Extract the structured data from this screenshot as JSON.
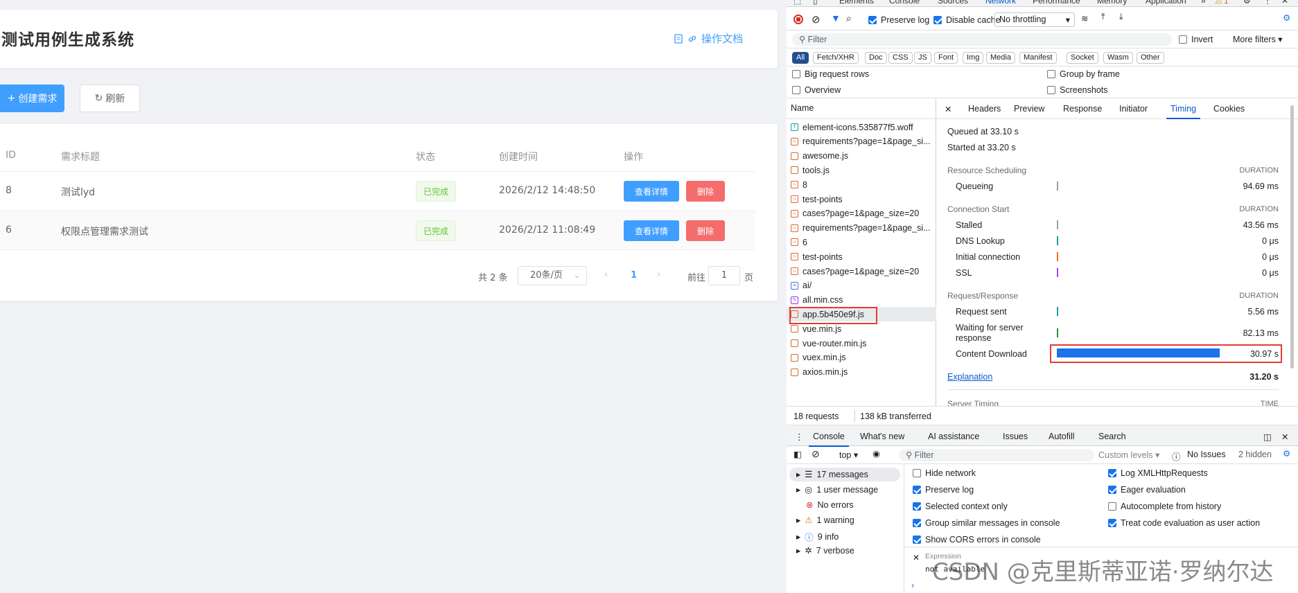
{
  "app": {
    "title": "测试用例生成系统",
    "doc_link": "操作文档",
    "create_btn": "创建需求",
    "refresh_btn": "刷新",
    "columns": [
      "ID",
      "需求标题",
      "状态",
      "创建时间",
      "操作"
    ],
    "rows": [
      {
        "id": "8",
        "title": "测试lyd",
        "status": "已完成",
        "created": "2026/2/12 14:48:50",
        "view": "查看详情",
        "del": "删除"
      },
      {
        "id": "6",
        "title": "权限点管理需求测试",
        "status": "已完成",
        "created": "2026/2/12 11:08:49",
        "view": "查看详情",
        "del": "删除"
      }
    ],
    "pagination": {
      "total": "共 2 条",
      "page_size": "20条/页",
      "current": "1",
      "goto_label": "前往",
      "goto_value": "1",
      "page_suffix": "页"
    }
  },
  "devtools": {
    "panels": [
      "Elements",
      "Console",
      "Sources",
      "Network",
      "Performance",
      "Memory",
      "Application"
    ],
    "active_panel": "Network",
    "warning_count": "1",
    "preserve_log": "Preserve log",
    "disable_cache": "Disable cache",
    "throttling": "No throttling",
    "filter_placeholder": "Filter",
    "invert": "Invert",
    "more_filters": "More filters",
    "types": [
      "All",
      "Fetch/XHR",
      "Doc",
      "CSS",
      "JS",
      "Font",
      "Img",
      "Media",
      "Manifest",
      "Socket",
      "Wasm",
      "Other"
    ],
    "options": {
      "big_rows": "Big request rows",
      "group_frame": "Group by frame",
      "overview": "Overview",
      "screenshots": "Screenshots"
    },
    "name_header": "Name",
    "requests": [
      {
        "name": "element-icons.535877f5.woff",
        "kind": "font"
      },
      {
        "name": "requirements?page=1&page_si...",
        "kind": "xhr"
      },
      {
        "name": "awesome.js",
        "kind": "js"
      },
      {
        "name": "tools.js",
        "kind": "js"
      },
      {
        "name": "8",
        "kind": "xhr"
      },
      {
        "name": "test-points",
        "kind": "xhr"
      },
      {
        "name": "cases?page=1&page_size=20",
        "kind": "xhr"
      },
      {
        "name": "requirements?page=1&page_si...",
        "kind": "xhr"
      },
      {
        "name": "6",
        "kind": "xhr"
      },
      {
        "name": "test-points",
        "kind": "xhr"
      },
      {
        "name": "cases?page=1&page_size=20",
        "kind": "xhr"
      },
      {
        "name": "ai/",
        "kind": "doc"
      },
      {
        "name": "all.min.css",
        "kind": "css"
      },
      {
        "name": "app.5b450e9f.js",
        "kind": "js",
        "selected": true
      },
      {
        "name": "vue.min.js",
        "kind": "js"
      },
      {
        "name": "vue-router.min.js",
        "kind": "js"
      },
      {
        "name": "vuex.min.js",
        "kind": "js"
      },
      {
        "name": "axios.min.js",
        "kind": "js"
      }
    ],
    "detail_tabs": [
      "Headers",
      "Preview",
      "Response",
      "Initiator",
      "Timing",
      "Cookies"
    ],
    "active_detail_tab": "Timing",
    "timing": {
      "queued": "Queued at 33.10 s",
      "started": "Started at 33.20 s",
      "duration_label": "DURATION",
      "sections": [
        {
          "name": "Resource Scheduling",
          "rows": [
            {
              "label": "Queueing",
              "value": "94.69 ms",
              "color": "#9e9e9e"
            }
          ]
        },
        {
          "name": "Connection Start",
          "rows": [
            {
              "label": "Stalled",
              "value": "43.56 ms",
              "color": "#9e9e9e"
            },
            {
              "label": "DNS Lookup",
              "value": "0 μs",
              "color": "#1a9c9c"
            },
            {
              "label": "Initial connection",
              "value": "0 μs",
              "color": "#e8710a"
            },
            {
              "label": "SSL",
              "value": "0 μs",
              "color": "#a142f4"
            }
          ]
        },
        {
          "name": "Request/Response",
          "rows": [
            {
              "label": "Request sent",
              "value": "5.56 ms",
              "color": "#1a9c9c"
            },
            {
              "label": "Waiting for server response",
              "value": "82.13 ms",
              "color": "#1e8e3e"
            },
            {
              "label": "Content Download",
              "value": "30.97 s",
              "color": "#1a73e8"
            }
          ]
        }
      ],
      "explanation": "Explanation",
      "total": "31.20 s",
      "server_timing": "Server Timing",
      "time_label": "TIME"
    },
    "status": {
      "requests": "18 requests",
      "transferred": "138 kB transferred"
    },
    "drawer_tabs": [
      "Console",
      "What's new",
      "AI assistance",
      "Issues",
      "Autofill",
      "Search"
    ],
    "console": {
      "context": "top",
      "filter": "Filter",
      "levels": "Custom levels",
      "issues": "No Issues",
      "hidden": "2 hidden",
      "sidebar": [
        "17 messages",
        "1 user message",
        "No errors",
        "1 warning",
        "9 info",
        "7 verbose"
      ],
      "settings_left": [
        {
          "label": "Hide network",
          "checked": false
        },
        {
          "label": "Preserve log",
          "checked": true
        },
        {
          "label": "Selected context only",
          "checked": true
        },
        {
          "label": "Group similar messages in console",
          "checked": true
        },
        {
          "label": "Show CORS errors in console",
          "checked": true
        }
      ],
      "settings_right": [
        {
          "label": "Log XMLHttpRequests",
          "checked": true
        },
        {
          "label": "Eager evaluation",
          "checked": true
        },
        {
          "label": "Autocomplete from history",
          "checked": false
        },
        {
          "label": "Treat code evaluation as user action",
          "checked": true
        }
      ],
      "expression_label": "Expression",
      "expression_value": "not available",
      "prompt": "›"
    },
    "watermark": "CSDN @克里斯蒂亚诺·罗纳尔达"
  }
}
